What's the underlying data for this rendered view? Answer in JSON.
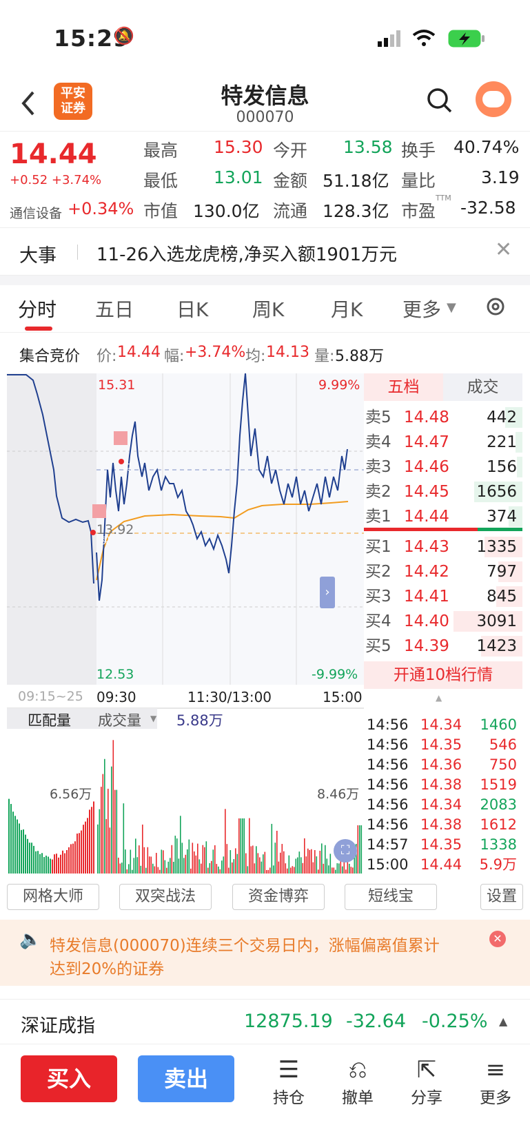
{
  "status_bar": {
    "time": "15:29"
  },
  "header": {
    "title": "特发信息",
    "code": "000070",
    "logo_line1": "平安",
    "logo_line2": "证券"
  },
  "quote": {
    "price": "14.44",
    "change": "+0.52 +3.74%",
    "sector": "通信设备",
    "sector_change": "+0.34%",
    "fields": [
      {
        "label": "最高",
        "value": "15.30"
      },
      {
        "label": "今开",
        "value": "13.58"
      },
      {
        "label": "换手",
        "value": "40.74%"
      },
      {
        "label": "最低",
        "value": "13.01"
      },
      {
        "label": "金额",
        "value": "51.18亿"
      },
      {
        "label": "量比",
        "value": "3.19"
      },
      {
        "label": "市值",
        "value": "130.0亿"
      },
      {
        "label": "流通",
        "value": "128.3亿"
      },
      {
        "label": "市盈",
        "value": "-32.58",
        "sup": "TTM"
      }
    ]
  },
  "banner": {
    "tag": "大事",
    "text": "11-26入选龙虎榜,净买入额1901万元"
  },
  "tabs": [
    "分时",
    "五日",
    "日K",
    "周K",
    "月K",
    "更多"
  ],
  "infoline": {
    "label": "集合竞价",
    "price_label": "价:",
    "price": "14.44",
    "amp_label": "幅:",
    "amp": "+3.74%",
    "avg_label": "均:",
    "avg": "14.13",
    "vol_label": "量:",
    "vol": "5.88万"
  },
  "chart": {
    "top_price": "15.31",
    "top_pct": "9.99%",
    "bottom_price": "12.53",
    "bottom_pct": "-9.99%",
    "ref_price": "13.92",
    "buy_mark": "买",
    "time_auction": "09:15~25",
    "time_open": "09:30",
    "time_mid": "11:30/13:00",
    "time_close": "15:00",
    "vol_label1": "匹配量",
    "vol_label2": "成交量",
    "vol_value": "5.88万",
    "vol_left_max": "6.56万",
    "vol_right_max": "8.46万"
  },
  "orderbook": {
    "tab_active": "五档",
    "tab_other": "成交",
    "asks": [
      {
        "label": "卖5",
        "price": "14.48",
        "qty": "442"
      },
      {
        "label": "卖4",
        "price": "14.47",
        "qty": "221"
      },
      {
        "label": "卖3",
        "price": "14.46",
        "qty": "156"
      },
      {
        "label": "卖2",
        "price": "14.45",
        "qty": "1656"
      },
      {
        "label": "卖1",
        "price": "14.44",
        "qty": "374"
      }
    ],
    "bids": [
      {
        "label": "买1",
        "price": "14.43",
        "qty": "1335"
      },
      {
        "label": "买2",
        "price": "14.42",
        "qty": "797"
      },
      {
        "label": "买3",
        "price": "14.41",
        "qty": "845"
      },
      {
        "label": "买4",
        "price": "14.40",
        "qty": "3091"
      },
      {
        "label": "买5",
        "price": "14.39",
        "qty": "1423"
      }
    ],
    "upgrade": "开通10档行情"
  },
  "ticks": [
    {
      "time": "14:56",
      "price": "14.34",
      "qty": "1460",
      "dir": "g"
    },
    {
      "time": "14:56",
      "price": "14.35",
      "qty": "546",
      "dir": "r"
    },
    {
      "time": "14:56",
      "price": "14.36",
      "qty": "750",
      "dir": "r"
    },
    {
      "time": "14:56",
      "price": "14.38",
      "qty": "1519",
      "dir": "r"
    },
    {
      "time": "14:56",
      "price": "14.34",
      "qty": "2083",
      "dir": "g"
    },
    {
      "time": "14:56",
      "price": "14.38",
      "qty": "1612",
      "dir": "r"
    },
    {
      "time": "14:57",
      "price": "14.35",
      "qty": "1338",
      "dir": "g"
    },
    {
      "time": "15:00",
      "price": "14.44",
      "qty": "5.9万",
      "dir": "r"
    }
  ],
  "tools": [
    "网格大师",
    "双突战法",
    "资金博弈",
    "短线宝",
    "设置"
  ],
  "notice": {
    "line1": "特发信息(000070)连续三个交易日内，涨幅偏离值累计",
    "line2": "达到20%的证券"
  },
  "index": {
    "name": "深证成指",
    "value": "12875.19",
    "change": "-32.64",
    "pct": "-0.25%"
  },
  "bottom": {
    "buy": "买入",
    "sell": "卖出",
    "items": [
      "持仓",
      "撤单",
      "分享",
      "更多"
    ]
  },
  "colors": {
    "up": "#e8292c",
    "down": "#13a45a",
    "line": "#1f3f8f",
    "avg": "#f29c1f",
    "sell_btn": "#4a90f5"
  }
}
